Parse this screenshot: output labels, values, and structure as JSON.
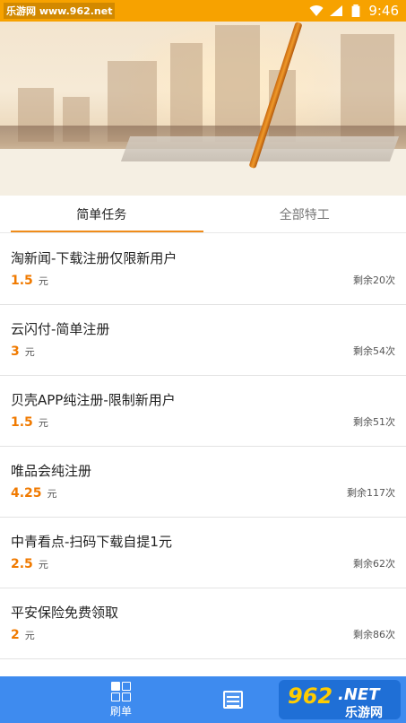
{
  "status_bar": {
    "watermark": "乐游网 www.962.net",
    "time": "9:46"
  },
  "tabs": [
    {
      "label": "简单任务",
      "active": true
    },
    {
      "label": "全部特工",
      "active": false
    }
  ],
  "tasks": [
    {
      "title": "淘新闻-下载注册仅限新用户",
      "price": "1.5",
      "unit": "元",
      "remaining": "剩余20次"
    },
    {
      "title": "云闪付-简单注册",
      "price": "3",
      "unit": "元",
      "remaining": "剩余54次"
    },
    {
      "title": "贝壳APP纯注册-限制新用户",
      "price": "1.5",
      "unit": "元",
      "remaining": "剩余51次"
    },
    {
      "title": "唯品会纯注册",
      "price": "4.25",
      "unit": "元",
      "remaining": "剩余117次"
    },
    {
      "title": "中青看点-扫码下载自提1元",
      "price": "2.5",
      "unit": "元",
      "remaining": "剩余62次"
    },
    {
      "title": "平安保险免费领取",
      "price": "2",
      "unit": "元",
      "remaining": "剩余86次"
    }
  ],
  "bottom_nav": {
    "items": [
      {
        "label": "刷单",
        "icon": "grid-icon"
      },
      {
        "label": "",
        "icon": "list-icon"
      }
    ]
  },
  "watermark_logo": {
    "number": "962",
    "suffix": ".NET",
    "name": "乐游网"
  },
  "colors": {
    "status_bar": "#f7a200",
    "accent": "#f08c1a",
    "price": "#f07a00",
    "bottom_nav": "#3e8bef"
  }
}
